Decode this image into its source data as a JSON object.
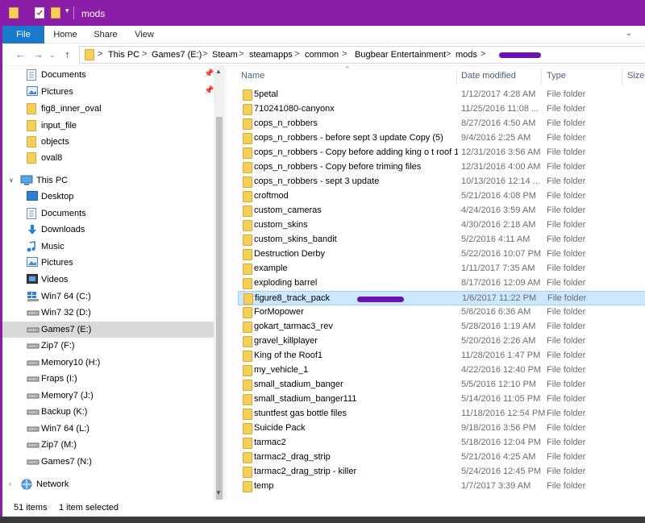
{
  "window": {
    "title": "mods",
    "accent": "#8a1ea6"
  },
  "ribbon": {
    "tabs": [
      "File",
      "Home",
      "Share",
      "View"
    ]
  },
  "address": {
    "crumbs": [
      "This PC",
      "Games7 (E:)",
      "Steam",
      "steamapps",
      "common",
      "Bugbear Entertainment",
      "mods"
    ],
    "separator": ">"
  },
  "nav": {
    "quick": [
      {
        "label": "Documents",
        "icon": "documents-icon",
        "pinned": true
      },
      {
        "label": "Pictures",
        "icon": "pictures-icon",
        "pinned": true
      },
      {
        "label": "fig8_inner_oval",
        "icon": "folder-icon"
      },
      {
        "label": "input_file",
        "icon": "folder-icon"
      },
      {
        "label": "objects",
        "icon": "folder-icon"
      },
      {
        "label": "oval8",
        "icon": "folder-icon"
      }
    ],
    "thispc_label": "This PC",
    "pc_items": [
      {
        "label": "Desktop",
        "icon": "desktop-icon"
      },
      {
        "label": "Documents",
        "icon": "documents-icon"
      },
      {
        "label": "Downloads",
        "icon": "downloads-icon"
      },
      {
        "label": "Music",
        "icon": "music-icon"
      },
      {
        "label": "Pictures",
        "icon": "pictures-icon"
      },
      {
        "label": "Videos",
        "icon": "videos-icon"
      },
      {
        "label": "Win7 64 (C:)",
        "icon": "drive-icon"
      },
      {
        "label": "Win7 32 (D:)",
        "icon": "drive-icon"
      },
      {
        "label": "Games7 (E:)",
        "icon": "drive-icon",
        "selected": true
      },
      {
        "label": "Zip7 (F:)",
        "icon": "drive-icon"
      },
      {
        "label": "Memory10 (H:)",
        "icon": "drive-icon"
      },
      {
        "label": "Fraps (I:)",
        "icon": "drive-icon"
      },
      {
        "label": "Memory7 (J:)",
        "icon": "drive-icon"
      },
      {
        "label": "Backup (K:)",
        "icon": "drive-icon"
      },
      {
        "label": "Win7 64 (L:)",
        "icon": "drive-icon"
      },
      {
        "label": "Zip7 (M:)",
        "icon": "drive-icon"
      },
      {
        "label": "Games7 (N:)",
        "icon": "drive-icon"
      }
    ],
    "network_label": "Network"
  },
  "columns": {
    "name": "Name",
    "date": "Date modified",
    "type": "Type",
    "size": "Size"
  },
  "files": [
    {
      "name": "5petal",
      "date": "1/12/2017 4:28 AM",
      "type": "File folder"
    },
    {
      "name": "710241080-canyonx",
      "date": "11/25/2016 11:08 ...",
      "type": "File folder"
    },
    {
      "name": "cops_n_robbers",
      "date": "8/27/2016 4:50 AM",
      "type": "File folder"
    },
    {
      "name": "cops_n_robbers - before sept 3 update Copy (5)",
      "date": "9/4/2016 2:25 AM",
      "type": "File folder"
    },
    {
      "name": "cops_n_robbers - Copy before adding king o t roof 1...",
      "date": "12/31/2016 3:56 AM",
      "type": "File folder"
    },
    {
      "name": "cops_n_robbers - Copy before triming files",
      "date": "12/31/2016 4:00 AM",
      "type": "File folder"
    },
    {
      "name": "cops_n_robbers - sept 3 update",
      "date": "10/13/2016 12:14 ...",
      "type": "File folder"
    },
    {
      "name": "croftmod",
      "date": "5/21/2016 4:08 PM",
      "type": "File folder"
    },
    {
      "name": "custom_cameras",
      "date": "4/24/2016 3:59 AM",
      "type": "File folder"
    },
    {
      "name": "custom_skins",
      "date": "4/30/2016 2:18 AM",
      "type": "File folder"
    },
    {
      "name": "custom_skins_bandit",
      "date": "5/2/2016 4:11 AM",
      "type": "File folder"
    },
    {
      "name": "Destruction Derby",
      "date": "5/22/2016 10:07 PM",
      "type": "File folder"
    },
    {
      "name": "example",
      "date": "1/11/2017 7:35 AM",
      "type": "File folder"
    },
    {
      "name": "exploding barrel",
      "date": "8/17/2016 12:09 AM",
      "type": "File folder"
    },
    {
      "name": "figure8_track_pack",
      "date": "1/6/2017 11:22 PM",
      "type": "File folder",
      "selected": true
    },
    {
      "name": "ForMopower",
      "date": "5/6/2016 6:36 AM",
      "type": "File folder"
    },
    {
      "name": "gokart_tarmac3_rev",
      "date": "5/28/2016 1:19 AM",
      "type": "File folder"
    },
    {
      "name": "gravel_killplayer",
      "date": "5/20/2016 2:26 AM",
      "type": "File folder"
    },
    {
      "name": "King of the Roof1",
      "date": "11/28/2016 1:47 PM",
      "type": "File folder"
    },
    {
      "name": "my_vehicle_1",
      "date": "4/22/2016 12:40 PM",
      "type": "File folder"
    },
    {
      "name": "small_stadium_banger",
      "date": "5/5/2016 12:10 PM",
      "type": "File folder"
    },
    {
      "name": "small_stadium_banger111",
      "date": "5/14/2016 11:05 PM",
      "type": "File folder"
    },
    {
      "name": "stuntfest gas bottle files",
      "date": "11/18/2016 12:54 PM",
      "type": "File folder"
    },
    {
      "name": "Suicide Pack",
      "date": "9/18/2016 3:56 PM",
      "type": "File folder"
    },
    {
      "name": "tarmac2",
      "date": "5/18/2016 12:04 PM",
      "type": "File folder"
    },
    {
      "name": "tarmac2_drag_strip",
      "date": "5/21/2016 4:25 AM",
      "type": "File folder"
    },
    {
      "name": "tarmac2_drag_strip - killer",
      "date": "5/24/2016 12:45 PM",
      "type": "File folder"
    },
    {
      "name": "temp",
      "date": "1/7/2017 3:39 AM",
      "type": "File folder"
    }
  ],
  "status": {
    "count": "51 items",
    "selected": "1 item selected"
  }
}
